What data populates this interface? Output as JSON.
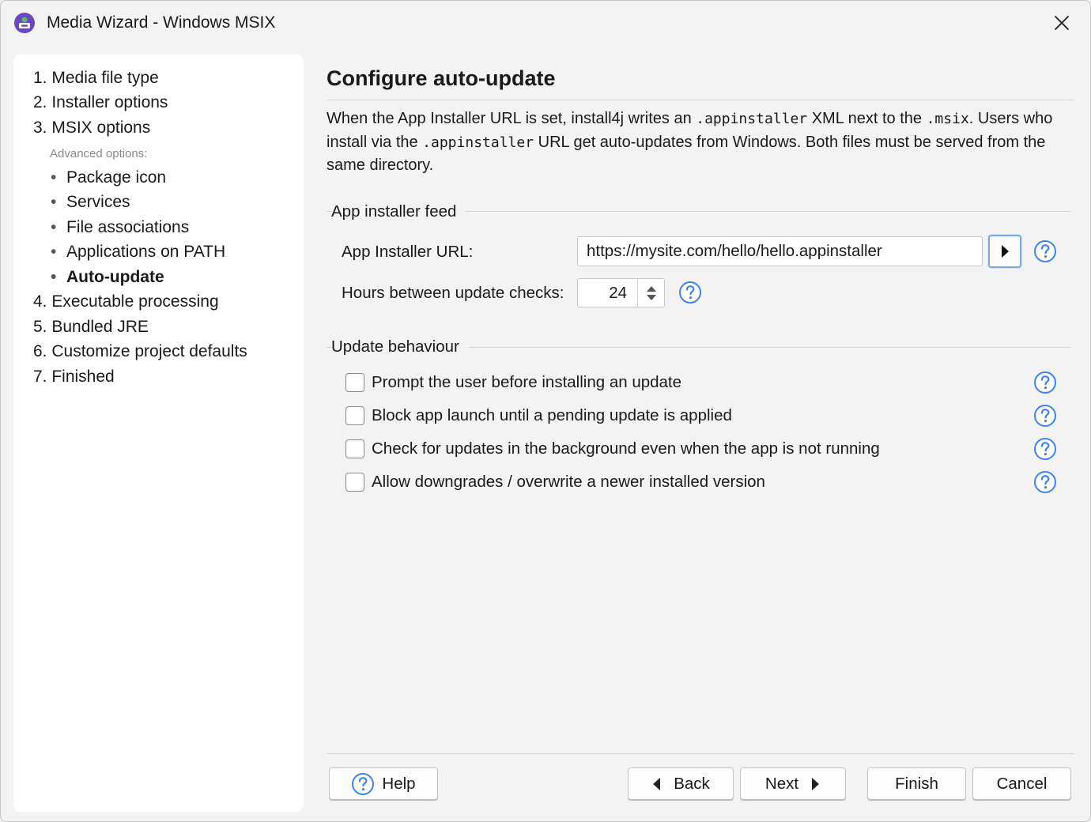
{
  "window": {
    "title": "Media Wizard - Windows MSIX"
  },
  "sidebar": {
    "steps_top": [
      {
        "label": "1. Media file type"
      },
      {
        "label": "2. Installer options"
      },
      {
        "label": "3. MSIX options"
      }
    ],
    "advanced_label": "Advanced options:",
    "sub_items": [
      {
        "label": "Package icon"
      },
      {
        "label": "Services"
      },
      {
        "label": "File associations"
      },
      {
        "label": "Applications on PATH"
      },
      {
        "label": "Auto-update",
        "active": true
      }
    ],
    "steps_bottom": [
      {
        "label": "4. Executable processing"
      },
      {
        "label": "5. Bundled JRE"
      },
      {
        "label": "6. Customize project defaults"
      },
      {
        "label": "7. Finished"
      }
    ],
    "bullet": "•"
  },
  "main": {
    "title": "Configure auto-update",
    "desc": {
      "p1": "When the App Installer URL is set, install4j writes an ",
      "code1": ".appinstaller",
      "p2": " XML next to the ",
      "code2": ".msix",
      "p3": ". Users who install via the ",
      "code3": ".appinstaller",
      "p4": " URL get auto-updates from Windows. Both files must be served from the same directory."
    },
    "feed": {
      "group_label": "App installer feed",
      "url_label": "App Installer URL:",
      "url_value": "https://mysite.com/hello/hello.appinstaller",
      "hours_label": "Hours between update checks:",
      "hours_value": "24"
    },
    "behaviour": {
      "group_label": "Update behaviour",
      "options": [
        {
          "label": "Prompt the user before installing an update",
          "checked": false
        },
        {
          "label": "Block app launch until a pending update is applied",
          "checked": false
        },
        {
          "label": "Check for updates in the background even when the app is not running",
          "checked": false
        },
        {
          "label": "Allow downgrades / overwrite a newer installed version",
          "checked": false
        }
      ]
    }
  },
  "buttons": {
    "help": "Help",
    "back": "Back",
    "next": "Next",
    "finish": "Finish",
    "cancel": "Cancel"
  },
  "icons": {
    "app": "app-icon",
    "close": "close-icon",
    "help": "help-icon",
    "arrow_right": "chevron-right-icon",
    "spinner": "spinner-arrows-icon"
  },
  "colors": {
    "accent": "#3b82f6",
    "app_icon_purple": "#6b46c1",
    "app_icon_green": "#5cb85c"
  }
}
